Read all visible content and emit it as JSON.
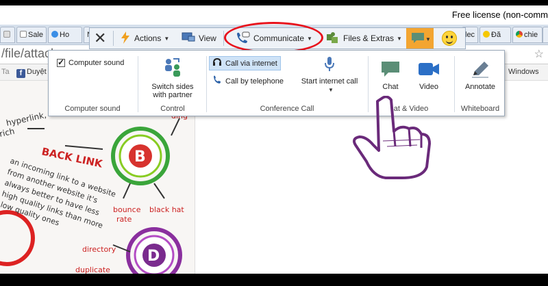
{
  "window": {
    "license_text": "Free license (non-comm"
  },
  "browser": {
    "tabs": [
      {
        "label": "",
        "icon": "page-icon"
      },
      {
        "label": "Sale",
        "icon": "page-icon"
      },
      {
        "label": "Ho",
        "icon": "bird-icon"
      },
      {
        "label": "Ne",
        "icon": "page-icon"
      },
      {
        "label": "lec",
        "icon": "page-icon"
      },
      {
        "label": "Đă",
        "icon": "star-icon"
      },
      {
        "label": "chie",
        "icon": "chrome-icon"
      },
      {
        "label": "",
        "icon": "chrome-icon"
      }
    ],
    "address": "/file/attach",
    "bookmarks": {
      "facebook_label": "Duyệt",
      "windows_label": "Windows"
    }
  },
  "toolbar": {
    "close_icon": "close-icon",
    "actions_label": "Actions",
    "view_label": "View",
    "communicate_label": "Communicate",
    "files_label": "Files & Extras",
    "chat_icon": "chat-bubble-icon",
    "smiley_icon": "smiley-icon",
    "highlight_color": "#e8121c"
  },
  "panel": {
    "computer_sound": {
      "option_label": "Computer sound",
      "checked": true,
      "group_label": "Computer sound"
    },
    "control": {
      "button_line1": "Switch sides",
      "button_line2": "with partner",
      "group_label": "Control"
    },
    "conference": {
      "option_internet": "Call via internet",
      "option_telephone": "Call by telephone",
      "start_call_label": "Start internet call",
      "group_label": "Conference Call"
    },
    "chat_video": {
      "chat_label": "Chat",
      "video_label": "Video",
      "group_label": "at & Video"
    },
    "whiteboard": {
      "annotate_label": "Annotate",
      "group_label": "Whiteboard"
    }
  },
  "background_image": {
    "texts": [
      "hyperlink,",
      "rich",
      "BACK LINK",
      "an incoming link to a website",
      "from another website it's",
      "always better to have less",
      "high quality links than more",
      "low quality ones",
      "bounce",
      "rate",
      "black hat",
      "directory",
      "duplicate",
      "ding",
      "B",
      "D"
    ]
  }
}
